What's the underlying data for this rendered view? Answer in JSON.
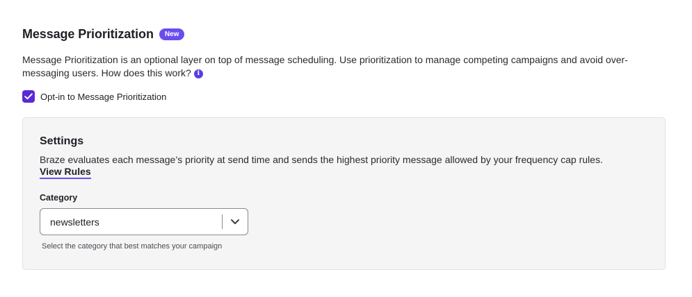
{
  "header": {
    "title": "Message Prioritization",
    "badge": "New"
  },
  "description": {
    "text": "Message Prioritization is an optional layer on top of message scheduling. Use prioritization to manage competing campaigns and avoid over-messaging users. How does this work?",
    "info_icon": "info-icon"
  },
  "optin": {
    "checked": true,
    "label": "Opt-in to Message Prioritization"
  },
  "settings": {
    "title": "Settings",
    "description": "Braze evaluates each message’s priority at send time and sends the highest priority message allowed by your frequency cap rules.",
    "view_rules_label": "View Rules",
    "category": {
      "label": "Category",
      "value": "newsletters",
      "helper": "Select the category that best matches your campaign"
    }
  },
  "colors": {
    "accent": "#6a4cf0",
    "checkbox": "#5b2ad6",
    "panel_bg": "#f5f5f6"
  }
}
